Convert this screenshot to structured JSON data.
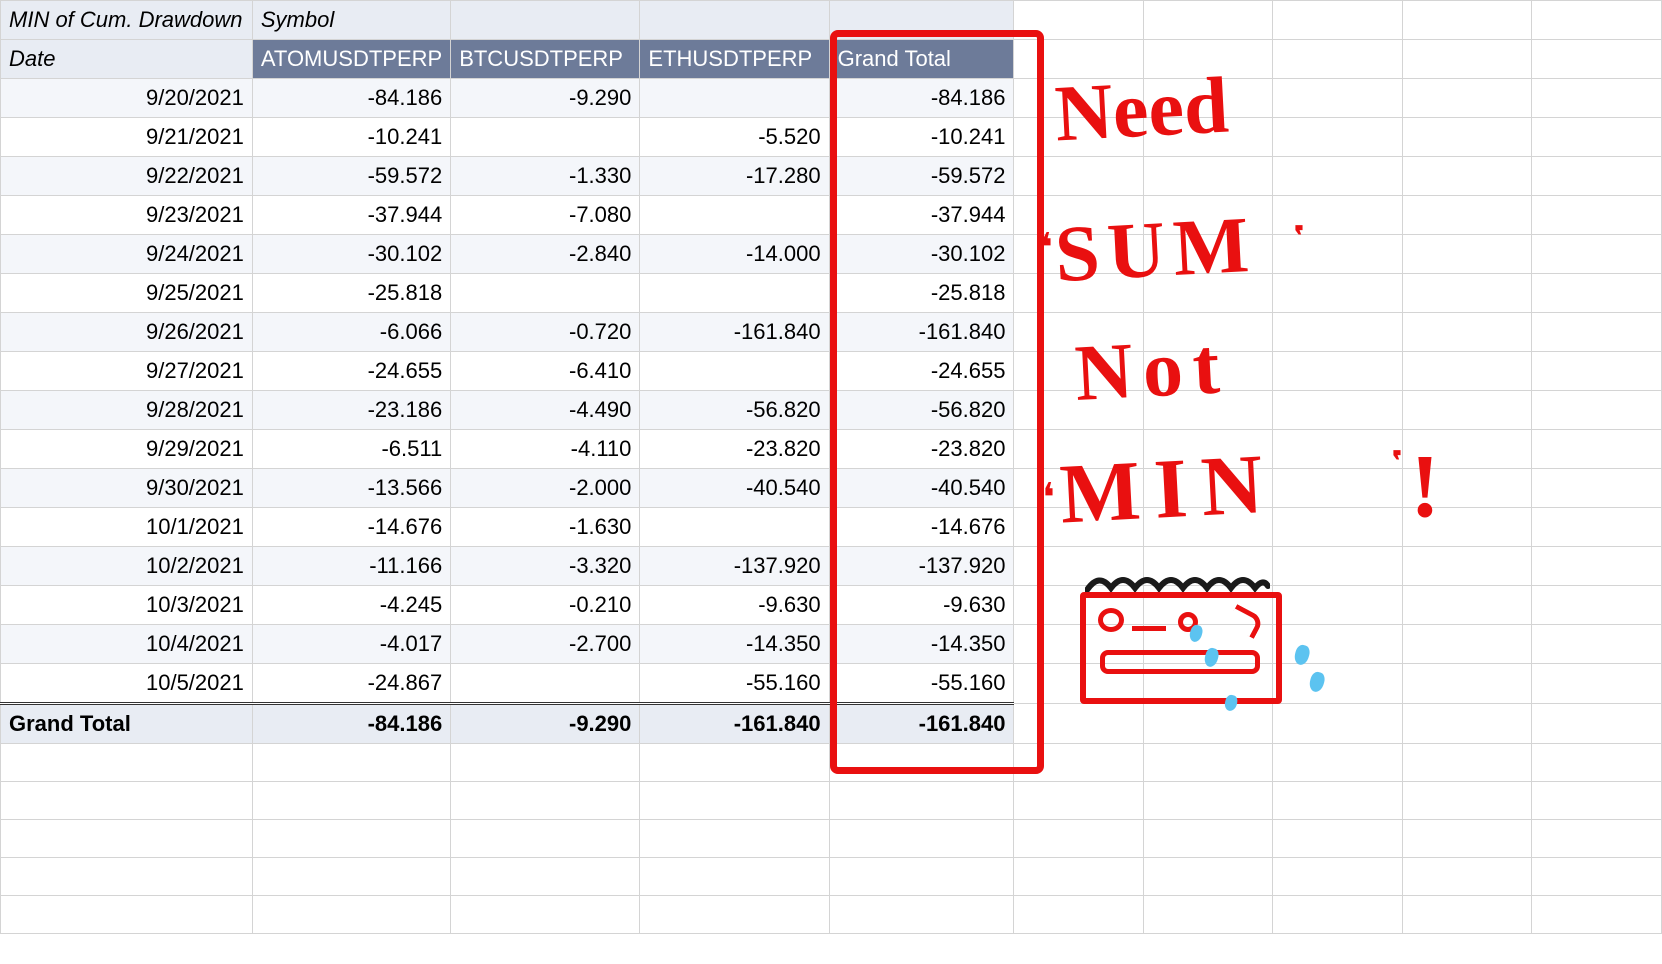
{
  "pivot": {
    "corner_label": "MIN of Cum. Drawdown",
    "col_field_label": "Symbol",
    "row_field_label": "Date",
    "column_headers": [
      "ATOMUSDTPERP",
      "BTCUSDTPERP",
      "ETHUSDTPERP",
      "Grand Total"
    ],
    "rows": [
      {
        "date": "9/20/2021",
        "atom": "-84.186",
        "btc": "-9.290",
        "eth": "",
        "total": "-84.186"
      },
      {
        "date": "9/21/2021",
        "atom": "-10.241",
        "btc": "",
        "eth": "-5.520",
        "total": "-10.241"
      },
      {
        "date": "9/22/2021",
        "atom": "-59.572",
        "btc": "-1.330",
        "eth": "-17.280",
        "total": "-59.572"
      },
      {
        "date": "9/23/2021",
        "atom": "-37.944",
        "btc": "-7.080",
        "eth": "",
        "total": "-37.944"
      },
      {
        "date": "9/24/2021",
        "atom": "-30.102",
        "btc": "-2.840",
        "eth": "-14.000",
        "total": "-30.102"
      },
      {
        "date": "9/25/2021",
        "atom": "-25.818",
        "btc": "",
        "eth": "",
        "total": "-25.818"
      },
      {
        "date": "9/26/2021",
        "atom": "-6.066",
        "btc": "-0.720",
        "eth": "-161.840",
        "total": "-161.840"
      },
      {
        "date": "9/27/2021",
        "atom": "-24.655",
        "btc": "-6.410",
        "eth": "",
        "total": "-24.655"
      },
      {
        "date": "9/28/2021",
        "atom": "-23.186",
        "btc": "-4.490",
        "eth": "-56.820",
        "total": "-56.820"
      },
      {
        "date": "9/29/2021",
        "atom": "-6.511",
        "btc": "-4.110",
        "eth": "-23.820",
        "total": "-23.820"
      },
      {
        "date": "9/30/2021",
        "atom": "-13.566",
        "btc": "-2.000",
        "eth": "-40.540",
        "total": "-40.540"
      },
      {
        "date": "10/1/2021",
        "atom": "-14.676",
        "btc": "-1.630",
        "eth": "",
        "total": "-14.676"
      },
      {
        "date": "10/2/2021",
        "atom": "-11.166",
        "btc": "-3.320",
        "eth": "-137.920",
        "total": "-137.920"
      },
      {
        "date": "10/3/2021",
        "atom": "-4.245",
        "btc": "-0.210",
        "eth": "-9.630",
        "total": "-9.630"
      },
      {
        "date": "10/4/2021",
        "atom": "-4.017",
        "btc": "-2.700",
        "eth": "-14.350",
        "total": "-14.350"
      },
      {
        "date": "10/5/2021",
        "atom": "-24.867",
        "btc": "",
        "eth": "-55.160",
        "total": "-55.160"
      }
    ],
    "grand_total_label": "Grand Total",
    "grand_total": {
      "atom": "-84.186",
      "btc": "-9.290",
      "eth": "-161.840",
      "total": "-161.840"
    }
  },
  "annotation": {
    "line1": "Need",
    "line2": "'SUM'",
    "line3": "Not",
    "line4": "'MIN'!"
  }
}
